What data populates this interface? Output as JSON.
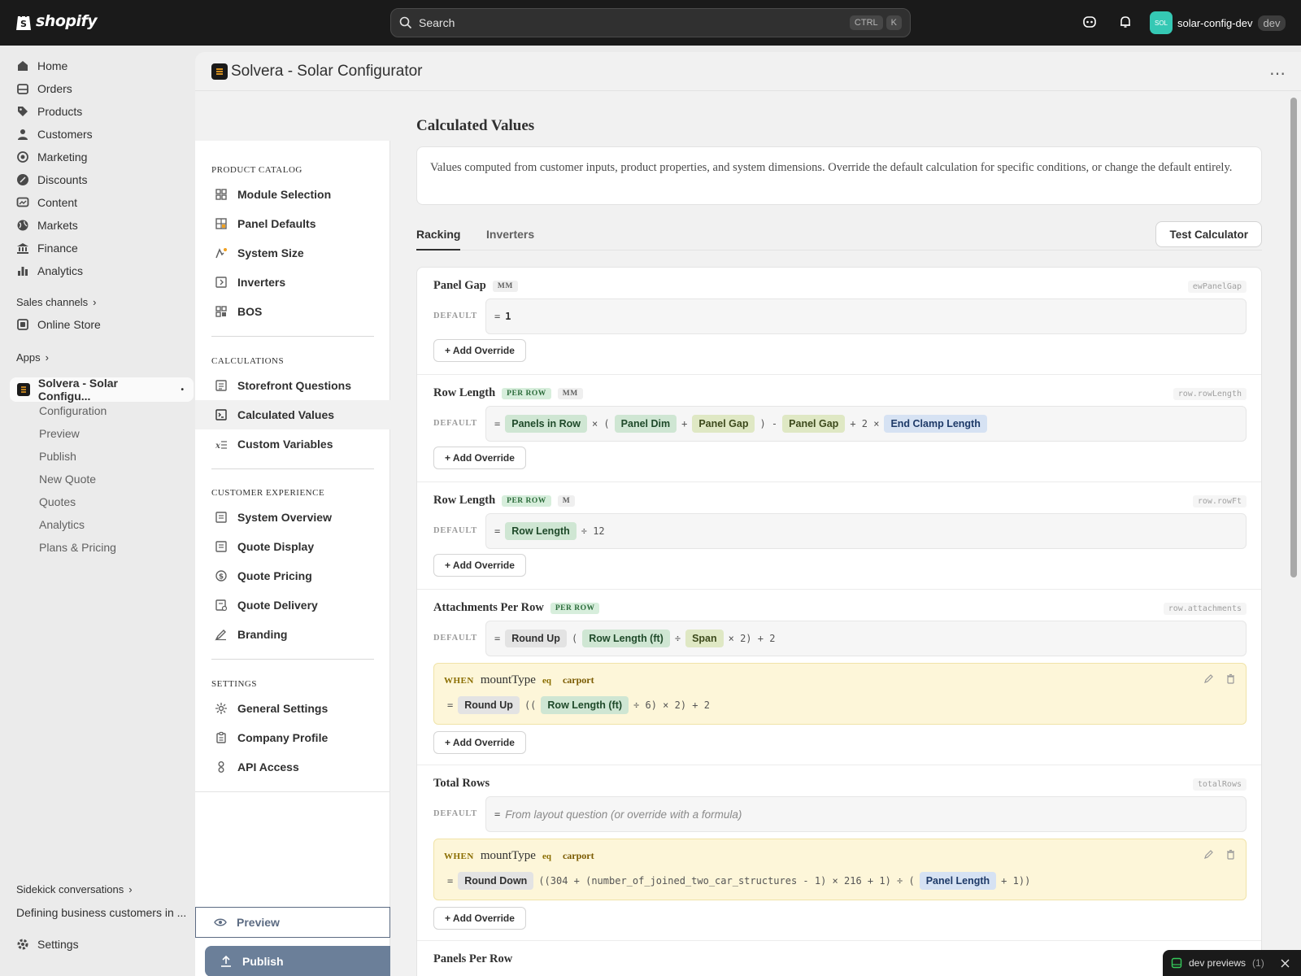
{
  "topbar": {
    "logo_text": "shopify",
    "search_placeholder": "Search",
    "search_kbd_1": "CTRL",
    "search_kbd_2": "K",
    "store_initials": "SOL",
    "store_name": "solar-config-dev",
    "store_badge": "dev"
  },
  "admin_nav": {
    "items": [
      {
        "label": "Home",
        "icon": "home-icon"
      },
      {
        "label": "Orders",
        "icon": "orders-icon"
      },
      {
        "label": "Products",
        "icon": "tag-icon"
      },
      {
        "label": "Customers",
        "icon": "person-icon"
      },
      {
        "label": "Marketing",
        "icon": "target-icon"
      },
      {
        "label": "Discounts",
        "icon": "discount-icon"
      },
      {
        "label": "Content",
        "icon": "content-icon"
      },
      {
        "label": "Markets",
        "icon": "globe-icon"
      },
      {
        "label": "Finance",
        "icon": "bank-icon"
      },
      {
        "label": "Analytics",
        "icon": "bar-chart-icon"
      }
    ],
    "sales_channels_label": "Sales channels",
    "online_store_label": "Online Store",
    "apps_label": "Apps",
    "active_app_label": "Solvera - Solar Configu...",
    "active_app_dot": "•",
    "app_subitems": [
      "Configuration",
      "Preview",
      "Publish",
      "New Quote",
      "Quotes",
      "Analytics",
      "Plans & Pricing"
    ],
    "sidekick_label": "Sidekick conversations",
    "sidekick_item": "Defining business customers in ...",
    "settings_label": "Settings"
  },
  "app": {
    "title": "Solvera - Solar Configurator",
    "more_icon": "⋯",
    "sidebar": {
      "sections": [
        {
          "title": "PRODUCT CATALOG",
          "items": [
            {
              "label": "Module Selection",
              "icon": "grid-icon"
            },
            {
              "label": "Panel Defaults",
              "icon": "panel-grid-icon"
            },
            {
              "label": "System Size",
              "icon": "spark-chart-icon"
            },
            {
              "label": "Inverters",
              "icon": "inverter-icon"
            },
            {
              "label": "BOS",
              "icon": "blocks-icon"
            }
          ]
        },
        {
          "title": "CALCULATIONS",
          "items": [
            {
              "label": "Storefront Questions",
              "icon": "form-icon"
            },
            {
              "label": "Calculated Values",
              "icon": "terminal-icon"
            },
            {
              "label": "Custom Variables",
              "icon": "variable-icon"
            }
          ]
        },
        {
          "title": "CUSTOMER EXPERIENCE",
          "items": [
            {
              "label": "System Overview",
              "icon": "doc-icon"
            },
            {
              "label": "Quote Display",
              "icon": "doc-icon"
            },
            {
              "label": "Quote Pricing",
              "icon": "dollar-icon"
            },
            {
              "label": "Quote Delivery",
              "icon": "delivery-icon"
            },
            {
              "label": "Branding",
              "icon": "pen-icon"
            }
          ]
        },
        {
          "title": "SETTINGS",
          "items": [
            {
              "label": "General Settings",
              "icon": "sun-gear-icon"
            },
            {
              "label": "Company Profile",
              "icon": "clipboard-icon"
            },
            {
              "label": "API Access",
              "icon": "link-icon"
            }
          ]
        }
      ],
      "preview_label": "Preview",
      "publish_label": "Publish"
    },
    "page_title": "Calculated Values",
    "description": "Values computed from customer inputs, product properties, and system dimensions. Override the default calculation for specific conditions, or change the default entirely.",
    "tabs": [
      "Racking",
      "Inverters"
    ],
    "active_tab": "Racking",
    "test_button": "Test Calculator",
    "default_label": "DEFAULT",
    "add_override_label": "+ Add Override",
    "eq": "=",
    "when": {
      "kw": "WHEN",
      "var": "mountType",
      "op": "eq",
      "val": "carport"
    },
    "calcs": [
      {
        "name": "Panel Gap",
        "unit": "MM",
        "key": "ewPanelGap",
        "default_value": "1"
      },
      {
        "name": "Row Length",
        "per_row": "PER ROW",
        "unit": "MM",
        "key": "row.rowLength",
        "tokens": [
          "Panels in Row",
          "× (",
          "Panel Dim",
          "+",
          "Panel Gap",
          ") -",
          "Panel Gap",
          "+ 2 ×",
          "End Clamp Length"
        ]
      },
      {
        "name": "Row Length",
        "per_row": "PER ROW",
        "unit": "M",
        "key": "row.rowFt",
        "tokens": [
          "Row Length",
          "÷ 12"
        ]
      },
      {
        "name": "Attachments Per Row",
        "per_row": "PER ROW",
        "key": "row.attachments",
        "tokens": [
          "Round Up",
          "(",
          "Row Length (ft)",
          "÷",
          "Span",
          "× 2) + 2"
        ],
        "override_tokens": [
          "Round Up",
          "((",
          "Row Length (ft)",
          "÷ 6) × 2) + 2"
        ]
      },
      {
        "name": "Total Rows",
        "key": "totalRows",
        "placeholder": "From layout question (or override with a formula)",
        "override_tokens": [
          "Round Down",
          "((304 + (number_of_joined_two_car_structures - 1) × 216 + 1) ÷ (",
          "Panel Length",
          "+ 1))"
        ]
      },
      {
        "name": "Panels Per Row"
      }
    ]
  },
  "toast": {
    "label": "dev previews",
    "count": "(1)"
  }
}
